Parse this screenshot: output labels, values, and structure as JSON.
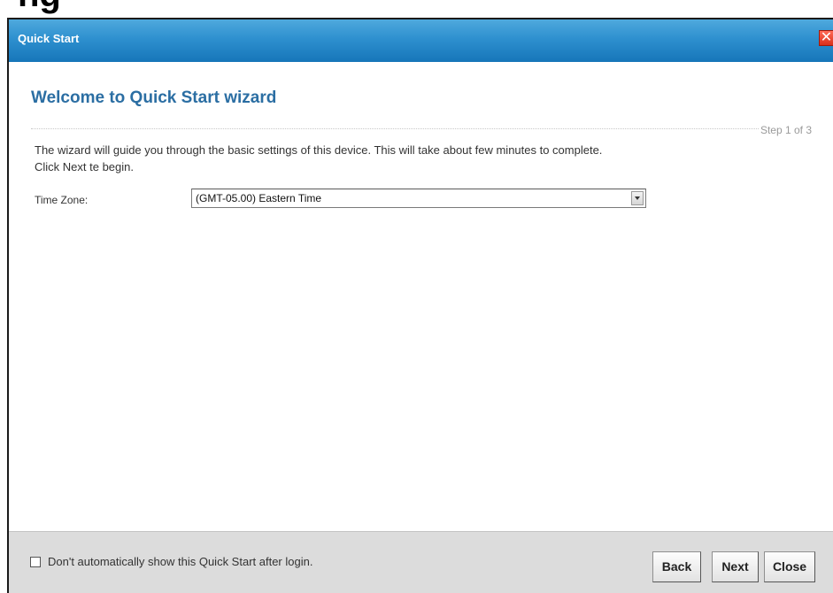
{
  "page": {
    "cropped_heading": "ng"
  },
  "dialog": {
    "title": "Quick Start",
    "close_symbol": "✕",
    "heading": "Welcome to Quick Start wizard",
    "step": "Step 1 of 3",
    "description_line1": "The wizard will guide you through the basic settings of this device. This will take about few minutes to complete.",
    "description_line2": "Click Next te begin.",
    "time_zone": {
      "label": "Time Zone:",
      "selected": "(GMT-05.00) Eastern Time"
    }
  },
  "footer": {
    "checkbox_label": "Don't automatically show this Quick Start after login.",
    "checkbox_checked": false,
    "back_label": "Back",
    "next_label": "Next",
    "close_label": "Close"
  },
  "colors": {
    "titlebar": "#2e90cf",
    "heading": "#2b6ea3",
    "footer": "#dcdcdc",
    "close_button": "#d92f1a"
  },
  "icons": {
    "close": "close-icon",
    "dropdown": "chevron-down-icon"
  }
}
